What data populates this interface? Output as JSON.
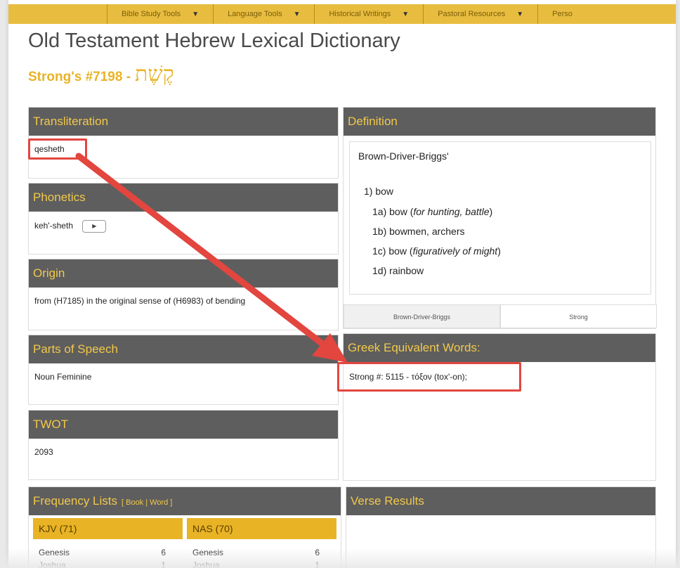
{
  "nav": {
    "items": [
      "Bible Study Tools",
      "Language Tools",
      "Historical Writings",
      "Pastoral Resources",
      "Perso"
    ]
  },
  "header": {
    "title": "Old Testament Hebrew Lexical Dictionary",
    "strongs_label": "Strong's #7198 -",
    "hebrew_word": "קֶשֶׁת"
  },
  "transliteration": {
    "title": "Transliteration",
    "value": "qesheth"
  },
  "phonetics": {
    "title": "Phonetics",
    "value": "keh'-sheth",
    "play_label": "▶"
  },
  "origin": {
    "title": "Origin",
    "value": "from (H7185) in the original sense of (H6983) of bending"
  },
  "parts_of_speech": {
    "title": "Parts of Speech",
    "value": "Noun Feminine"
  },
  "twot": {
    "title": "TWOT",
    "value": "2093"
  },
  "definition": {
    "title": "Definition",
    "source": "Brown-Driver-Briggs'",
    "lines": [
      {
        "text": "1) bow",
        "italic": ""
      },
      {
        "text": "1a) bow (",
        "italic": "for hunting, battle",
        "after": ")"
      },
      {
        "text": "1b) bowmen, archers",
        "italic": ""
      },
      {
        "text": "1c) bow (",
        "italic": "figuratively of might",
        "after": ")"
      },
      {
        "text": "1d) rainbow",
        "italic": ""
      }
    ],
    "tabs": [
      "Brown-Driver-Briggs",
      "Strong"
    ]
  },
  "greek": {
    "title": "Greek Equivalent Words:",
    "value": "Strong #: 5115 - τόξον (tox'-on);"
  },
  "frequency": {
    "title": "Frequency Lists",
    "links": "[ Book | Word ]",
    "columns": [
      {
        "label": "KJV (71)",
        "rows": [
          {
            "book": "Genesis",
            "count": "6"
          },
          {
            "book": "Joshua",
            "count": "1"
          }
        ]
      },
      {
        "label": "NAS (70)",
        "rows": [
          {
            "book": "Genesis",
            "count": "6"
          },
          {
            "book": "Joshua",
            "count": "1"
          }
        ]
      }
    ]
  },
  "verse_results": {
    "title": "Verse Results"
  },
  "colors": {
    "accent": "#e8bd3f",
    "header_bg": "#5e5e5e",
    "highlight": "#e2463f"
  }
}
